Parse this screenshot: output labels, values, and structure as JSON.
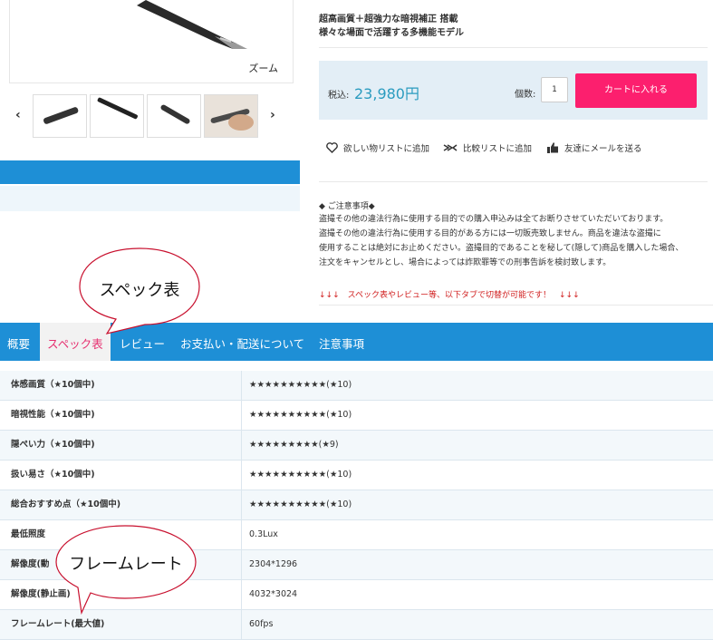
{
  "gallery": {
    "zoom_label": "ズーム",
    "prev_arrow": "‹",
    "next_arrow": "›"
  },
  "product": {
    "subtitle_line1": "超高画質＋超強力な暗視補正 搭載",
    "subtitle_line2": "様々な場面で活躍する多機能モデル",
    "price_label": "税込:",
    "price": "23,980円",
    "qty_label": "個数:",
    "qty_value": "1",
    "cart_button": "カートに入れる"
  },
  "actions": [
    {
      "label": "欲しい物リストに追加",
      "icon": "heart-icon"
    },
    {
      "label": "比較リストに追加",
      "icon": "compare-arrows-icon"
    },
    {
      "label": "友達にメールを送る",
      "icon": "thumbs-up-icon"
    }
  ],
  "notice": {
    "title": "◆ ご注意事項◆",
    "lines": [
      "盗撮その他の違法行為に使用する目的での購入申込みは全てお断りさせていただいております。",
      "盗撮その他の違法行為に使用する目的がある方には一切販売致しません。商品を違法な盗撮に",
      "使用することは絶対にお止めください。盗撮目的であることを秘して(隠して)商品を購入した場合、",
      "注文をキャンセルとし、場合によっては詐欺罪等での刑事告訴を検討致します。"
    ],
    "red_note": "↓↓↓　スペック表やレビュー等、以下タブで切替が可能です！　↓↓↓"
  },
  "callouts": {
    "spec": "スペック表",
    "framerate": "フレームレート"
  },
  "tabs": [
    {
      "label": "概要",
      "active": false
    },
    {
      "label": "スペック表",
      "active": true
    },
    {
      "label": "レビュー",
      "active": false
    },
    {
      "label": "お支払い・配送について",
      "active": false
    },
    {
      "label": "注意事項",
      "active": false
    }
  ],
  "spec_rows": [
    {
      "label": "体感画質（★10個中)",
      "value": "★★★★★★★★★★(★10)"
    },
    {
      "label": "暗視性能（★10個中)",
      "value": "★★★★★★★★★★(★10)"
    },
    {
      "label": "隠ぺい力（★10個中)",
      "value": "★★★★★★★★★(★9)"
    },
    {
      "label": "扱い易さ（★10個中)",
      "value": "★★★★★★★★★★(★10)"
    },
    {
      "label": "総合おすすめ点（★10個中)",
      "value": "★★★★★★★★★★(★10)"
    },
    {
      "label": "最低照度",
      "value": "0.3Lux"
    },
    {
      "label": "解像度(動",
      "value": "2304*1296"
    },
    {
      "label": "解像度(静止画)",
      "value": "4032*3024"
    },
    {
      "label": "フレームレート(最大値)",
      "value": "60fps"
    }
  ],
  "colors": {
    "accent_blue": "#1e8fd6",
    "cart_pink": "#fc1f6e",
    "price_teal": "#2a9bbf",
    "warning_red": "#d01d1d"
  }
}
